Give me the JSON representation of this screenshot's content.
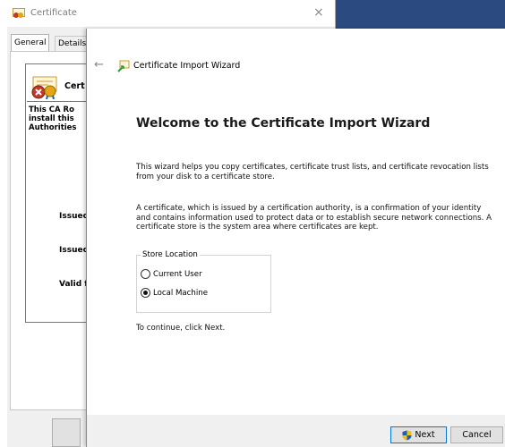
{
  "background": {
    "accent": "#2b4a80"
  },
  "cert_dialog": {
    "title": "Certificate",
    "close_glyph": "×",
    "tabs": [
      {
        "label": "General"
      },
      {
        "label": "Details"
      }
    ],
    "info_head": "Cert",
    "info_lines": [
      "This CA Ro",
      "install this",
      "Authorities"
    ],
    "issued_to": "Issued",
    "issued_by": "Issued",
    "valid_from": "Valid f"
  },
  "wizard": {
    "close_glyph": "×",
    "back_glyph": "←",
    "title": "Certificate Import Wizard",
    "heading": "Welcome to the Certificate Import Wizard",
    "para1": "This wizard helps you copy certificates, certificate trust lists, and certificate revocation lists from your disk to a certificate store.",
    "para2": "A certificate, which is issued by a certification authority, is a confirmation of your identity and contains information used to protect data or to establish secure network connections. A certificate store is the system area where certificates are kept.",
    "store_location": {
      "legend": "Store Location",
      "options": [
        {
          "label": "Current User",
          "checked": false
        },
        {
          "label": "Local Machine",
          "checked": true
        }
      ]
    },
    "continue_text": "To continue, click Next.",
    "next_label": "Next",
    "cancel_label": "Cancel"
  }
}
